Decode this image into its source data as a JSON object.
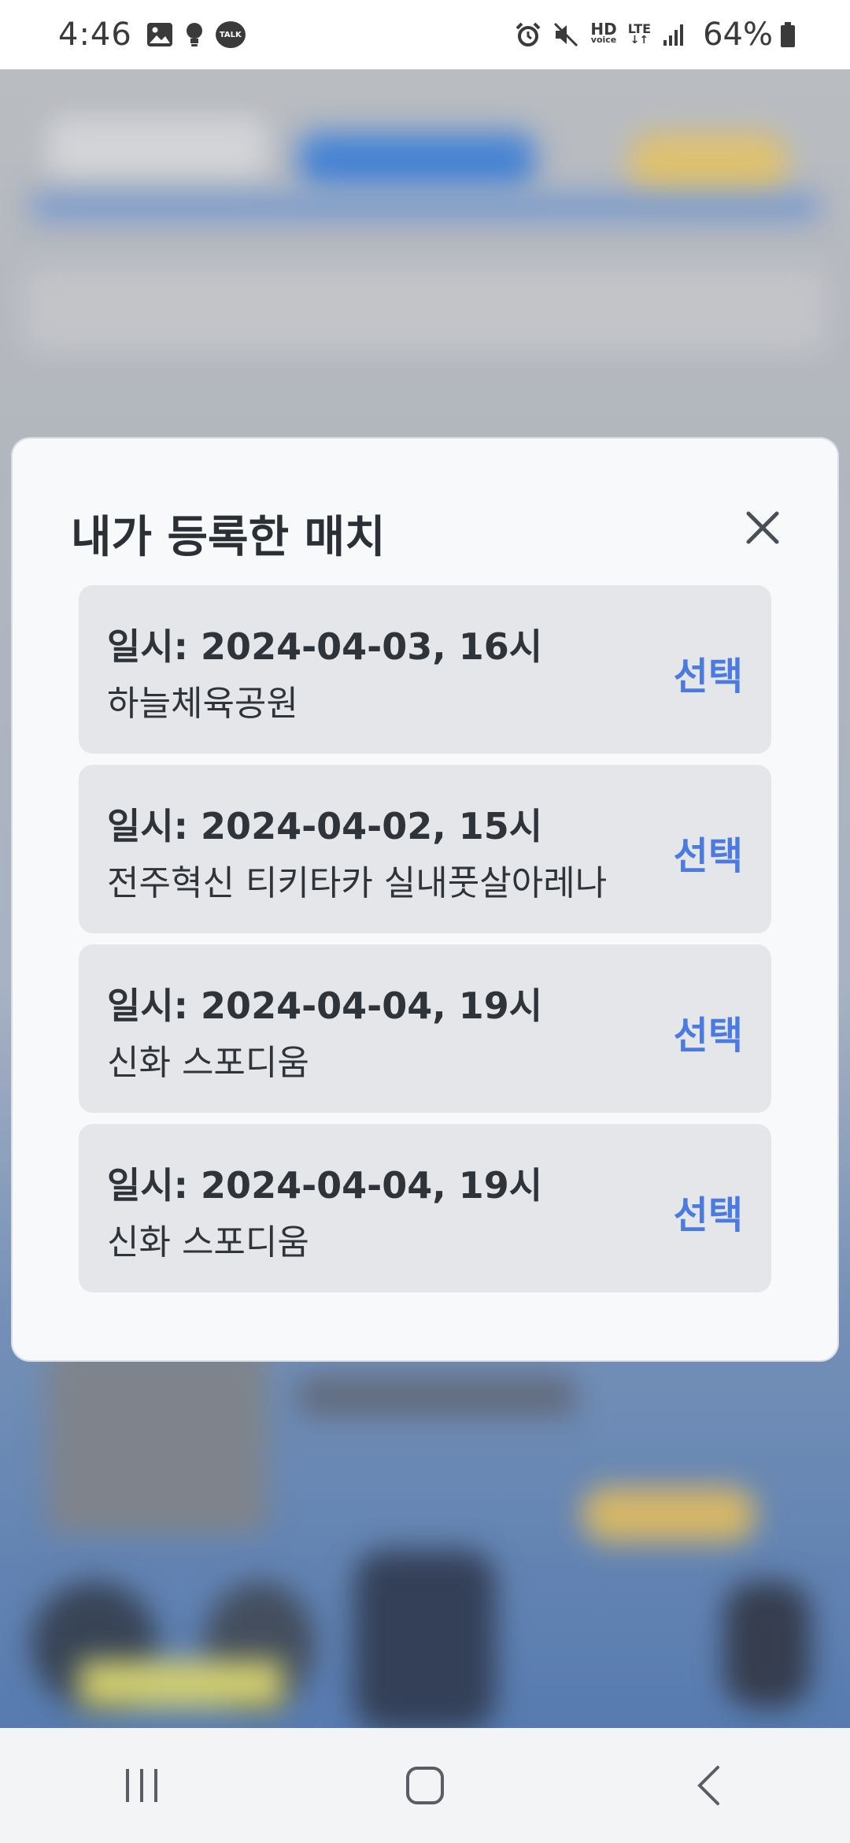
{
  "status_bar": {
    "time": "4:46",
    "talk_label": "TALK",
    "hd_label": "HD",
    "voice_label": "voice",
    "lte_label": "LTE",
    "battery_percent": "64%",
    "left_icons": [
      "gallery-icon",
      "bulb-icon",
      "talk-icon"
    ],
    "right_icons": [
      "alarm-icon",
      "mute-icon",
      "hd-voice-icon",
      "lte-icon",
      "signal-icon",
      "battery-icon"
    ]
  },
  "modal": {
    "title": "내가 등록한 매치",
    "close_icon": "close-icon",
    "matches": [
      {
        "date": "일시: 2024-04-03, 16시",
        "venue": "하늘체육공원",
        "select_label": "선택"
      },
      {
        "date": "일시: 2024-04-02, 15시",
        "venue": "전주혁신 티키타카 실내풋살아레나",
        "select_label": "선택"
      },
      {
        "date": "일시: 2024-04-04, 19시",
        "venue": "신화 스포디움",
        "select_label": "선택"
      },
      {
        "date": "일시: 2024-04-04, 19시",
        "venue": "신화 스포디움",
        "select_label": "선택"
      }
    ]
  },
  "nav_bar": {
    "icons": [
      "recent-apps-icon",
      "home-icon",
      "back-icon"
    ]
  },
  "colors": {
    "accent": "#4b7be0",
    "card_bg": "#e4e6ea",
    "modal_bg": "#f8f9fb",
    "title_text": "#2b2f36"
  }
}
